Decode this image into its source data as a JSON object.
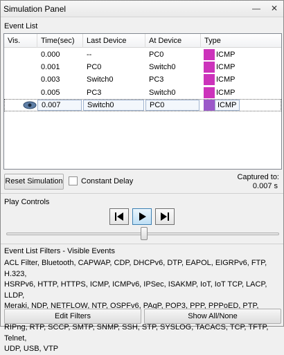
{
  "window": {
    "title": "Simulation Panel",
    "minimize_glyph": "—",
    "close_glyph": "✕"
  },
  "event_list": {
    "label": "Event List",
    "columns": [
      "Vis.",
      "Time(sec)",
      "Last Device",
      "At Device",
      "Type"
    ],
    "rows": [
      {
        "visible_icon": false,
        "time": "0.000",
        "last_device": "--",
        "at_device": "PC0",
        "type": "ICMP",
        "color": "#cc33bb",
        "selected": false
      },
      {
        "visible_icon": false,
        "time": "0.001",
        "last_device": "PC0",
        "at_device": "Switch0",
        "type": "ICMP",
        "color": "#cc33bb",
        "selected": false
      },
      {
        "visible_icon": false,
        "time": "0.003",
        "last_device": "Switch0",
        "at_device": "PC3",
        "type": "ICMP",
        "color": "#cc33bb",
        "selected": false
      },
      {
        "visible_icon": false,
        "time": "0.005",
        "last_device": "PC3",
        "at_device": "Switch0",
        "type": "ICMP",
        "color": "#cc33bb",
        "selected": false
      },
      {
        "visible_icon": true,
        "time": "0.007",
        "last_device": "Switch0",
        "at_device": "PC0",
        "type": "ICMP",
        "color": "#9b59c9",
        "selected": true
      }
    ]
  },
  "controls": {
    "reset_label": "Reset Simulation",
    "constant_delay_label": "Constant Delay",
    "constant_delay_checked": false,
    "captured_label": "Captured to:",
    "captured_value": "0.007 s"
  },
  "play_controls": {
    "label": "Play Controls",
    "buttons": [
      "step-back-icon",
      "play-icon",
      "step-forward-icon"
    ],
    "slider_position": 0.5
  },
  "filters": {
    "label": "Event List Filters - Visible Events",
    "lines": [
      "ACL Filter, Bluetooth, CAPWAP, CDP, DHCPv6, DTP, EAPOL, EIGRPv6, FTP, H.323,",
      "HSRPv6, HTTP, HTTPS, ICMP, ICMPv6, IPSec, ISAKMP, IoT, IoT TCP, LACP, LLDP,",
      "Meraki, NDP, NETFLOW, NTP, OSPFv6, PAgP, POP3, PPP, PPPoED, PTP, RADIUS, REP,",
      "RIPng, RTP, SCCP, SMTP, SNMP, SSH, STP, SYSLOG, TACACS, TCP, TFTP, Telnet,",
      "UDP, USB, VTP"
    ],
    "edit_label": "Edit Filters",
    "show_all_label": "Show All/None"
  }
}
